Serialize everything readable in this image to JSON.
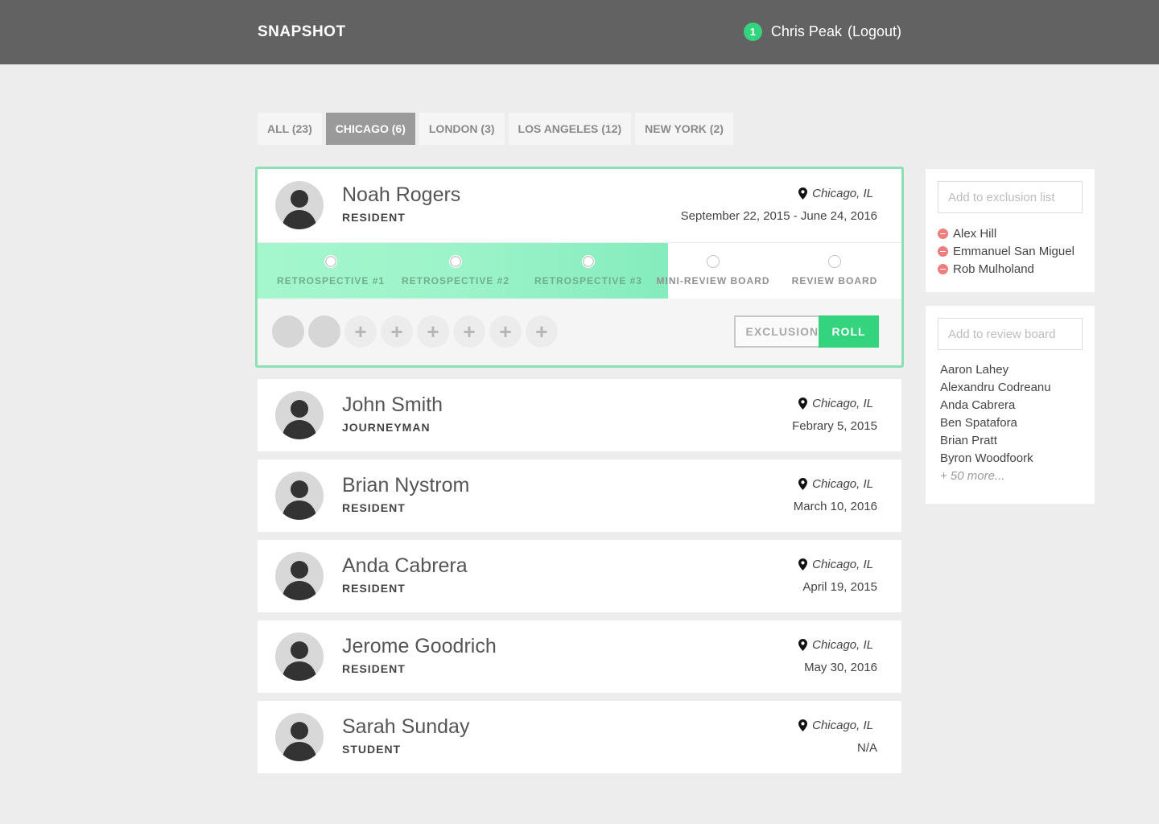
{
  "header": {
    "brand": "SNAPSHOT",
    "notification_count": "1",
    "user_name": "Chris Peak",
    "logout_label": "(Logout)"
  },
  "tabs": [
    {
      "label": "ALL (23)",
      "active": false
    },
    {
      "label": "CHICAGO (6)",
      "active": true
    },
    {
      "label": "LONDON (3)",
      "active": false
    },
    {
      "label": "LOS ANGELES (12)",
      "active": false
    },
    {
      "label": "NEW YORK (2)",
      "active": false
    }
  ],
  "people": [
    {
      "name": "Noah Rogers",
      "role": "RESIDENT",
      "location": "Chicago, IL",
      "date": "September 22, 2015 - June 24, 2016"
    },
    {
      "name": "John Smith",
      "role": "JOURNEYMAN",
      "location": "Chicago, IL",
      "date": "Febrary 5, 2015"
    },
    {
      "name": "Brian Nystrom",
      "role": "RESIDENT",
      "location": "Chicago, IL",
      "date": "March 10, 2016"
    },
    {
      "name": "Anda Cabrera",
      "role": "RESIDENT",
      "location": "Chicago, IL",
      "date": "April 19, 2015"
    },
    {
      "name": "Jerome Goodrich",
      "role": "RESIDENT",
      "location": "Chicago, IL",
      "date": "May 30, 2016"
    },
    {
      "name": "Sarah Sunday",
      "role": "STUDENT",
      "location": "Chicago, IL",
      "date": "N/A"
    }
  ],
  "expanded": {
    "steps": [
      {
        "label": "RETROSPECTIVE #1",
        "done": true
      },
      {
        "label": "RETROSPECTIVE #2",
        "done": true
      },
      {
        "label": "RETROSPECTIVE #3",
        "done": true
      },
      {
        "label": "MINI-REVIEW BOARD",
        "done": false
      },
      {
        "label": "REVIEW BOARD",
        "done": false
      }
    ],
    "add_symbol": "+",
    "exclusions_label": "EXCLUSIONS",
    "roll_label": "ROLL"
  },
  "exclusion_panel": {
    "placeholder": "Add to exclusion list",
    "items": [
      "Alex Hill",
      "Emmanuel San Miguel",
      "Rob Mulholand"
    ]
  },
  "review_panel": {
    "placeholder": "Add to review board",
    "items": [
      "Aaron Lahey",
      "Alexandru Codreanu",
      "Anda Cabrera",
      "Ben Spatafora",
      "Brian Pratt",
      "Byron Woodfoork"
    ],
    "more": "+ 50 more..."
  },
  "colors": {
    "accent": "#34d37e",
    "header_bg": "#626262",
    "remove": "#ef7d7d"
  }
}
